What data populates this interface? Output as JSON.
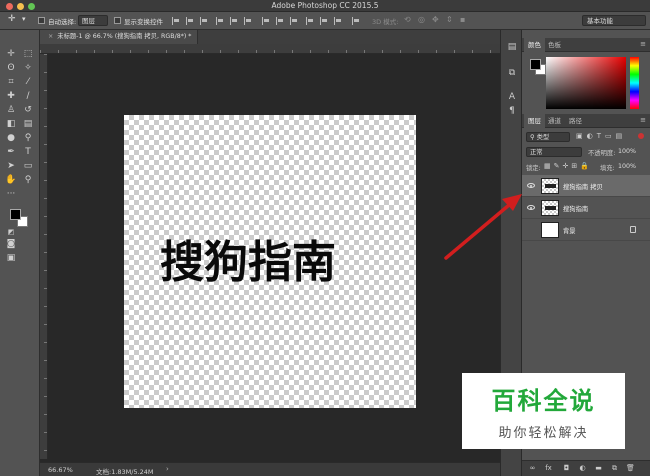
{
  "window": {
    "title": "Adobe Photoshop CC 2015.5"
  },
  "options_bar": {
    "auto_select_label": "自动选择:",
    "auto_select_value": "图层",
    "show_transform_label": "显示变换控件",
    "mode_3d_label": "3D 模式:"
  },
  "workspace": {
    "selected": "基本功能"
  },
  "document": {
    "tab_label": "未标题-1 @ 66.7% (搜狗指南 拷贝, RGB/8*) *",
    "canvas_text": "搜狗指南"
  },
  "status": {
    "zoom": "66.67%",
    "doc_size": "文档:1.83M/5.24M"
  },
  "color_panel": {
    "tabs": [
      "颜色",
      "色板"
    ],
    "fg_color": "#000000",
    "bg_color": "#ffffff"
  },
  "layers_panel": {
    "tabs": [
      "图层",
      "通道",
      "路径"
    ],
    "filter_kind": "类型",
    "blend_mode": "正常",
    "opacity_label": "不透明度:",
    "opacity_value": "100%",
    "lock_label": "锁定:",
    "fill_label": "填充:",
    "fill_value": "100%",
    "layers": [
      {
        "name": "搜狗指南 拷贝",
        "selected": true,
        "visible": true
      },
      {
        "name": "搜狗指南",
        "selected": false,
        "visible": true
      },
      {
        "name": "背景",
        "selected": false,
        "visible": false,
        "locked": true
      }
    ]
  },
  "annotation": {
    "arrow_color": "#d21e1e"
  },
  "watermark": {
    "title": "百科全说",
    "subtitle": "助你轻松解决"
  }
}
